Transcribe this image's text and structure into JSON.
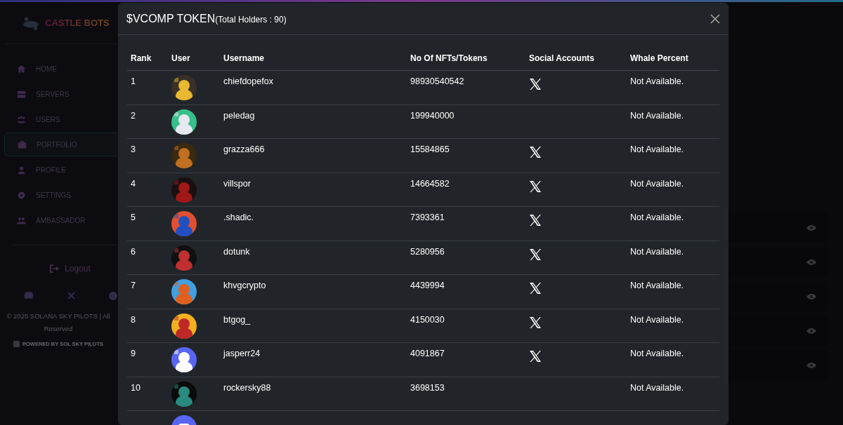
{
  "sidebar": {
    "logo": "CASTLE BOTS",
    "items": [
      {
        "label": "HOME",
        "selected": false
      },
      {
        "label": "SERVERS",
        "selected": false
      },
      {
        "label": "USERS",
        "selected": false
      },
      {
        "label": "PORTFOLIO",
        "selected": true
      },
      {
        "label": "PROFILE",
        "selected": false
      },
      {
        "label": "SETTINGS",
        "selected": false
      },
      {
        "label": "AMBASSADOR",
        "selected": false
      }
    ],
    "logout": "Logout",
    "footer": [
      "© 2025 SOLANA SKY PILOTS | All",
      "Reserved"
    ],
    "powered_by": "POWERED BY SOL SKY PILOTS"
  },
  "modal": {
    "title": "$VCOMP TOKEN",
    "subtitle": "(Total Holders : 90)",
    "columns": [
      "Rank",
      "User",
      "Username",
      "No Of NFTs/Tokens",
      "Social Accounts",
      "Whale Percent"
    ],
    "rows": [
      {
        "rank": "1",
        "username": "chiefdopefox",
        "amount": "98930540542",
        "x_account": true,
        "whale": "Not Available."
      },
      {
        "rank": "2",
        "username": "peledag",
        "amount": "199940000",
        "x_account": false,
        "whale": "Not Available."
      },
      {
        "rank": "3",
        "username": "grazza666",
        "amount": "15584865",
        "x_account": true,
        "whale": "Not Available."
      },
      {
        "rank": "4",
        "username": "villspor",
        "amount": "14664582",
        "x_account": true,
        "whale": "Not Available."
      },
      {
        "rank": "5",
        "username": ".shadic.",
        "amount": "7393361",
        "x_account": true,
        "whale": "Not Available."
      },
      {
        "rank": "6",
        "username": "dotunk",
        "amount": "5280956",
        "x_account": true,
        "whale": "Not Available."
      },
      {
        "rank": "7",
        "username": "khvgcrypto",
        "amount": "4439994",
        "x_account": true,
        "whale": "Not Available."
      },
      {
        "rank": "8",
        "username": "btgog_",
        "amount": "4150030",
        "x_account": true,
        "whale": "Not Available."
      },
      {
        "rank": "9",
        "username": "jasperr24",
        "amount": "4091867",
        "x_account": true,
        "whale": "Not Available."
      },
      {
        "rank": "10",
        "username": "rockersky88",
        "amount": "3698153",
        "x_account": false,
        "whale": "Not Available."
      }
    ]
  }
}
